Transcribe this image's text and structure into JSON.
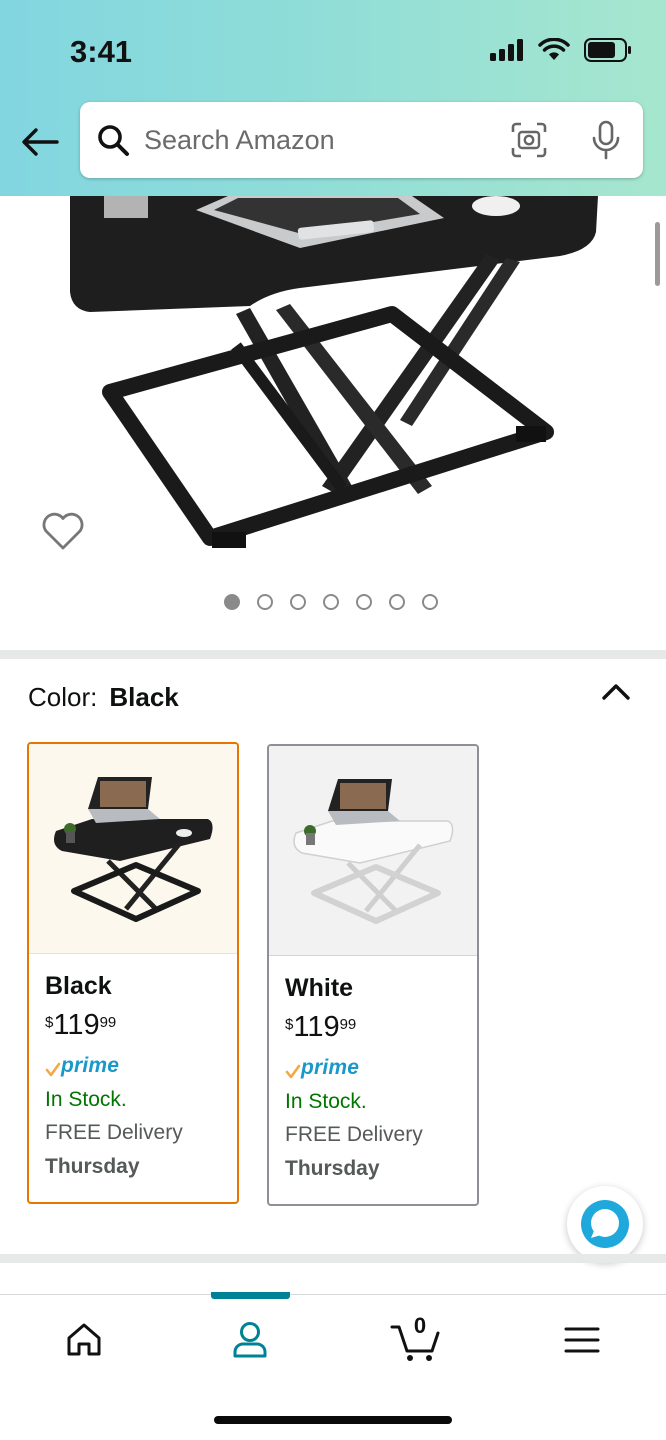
{
  "status_bar": {
    "time": "3:41"
  },
  "search": {
    "placeholder": "Search Amazon"
  },
  "image_gallery": {
    "total_images": 7,
    "active_index": 1
  },
  "color_selector": {
    "label": "Color:",
    "selected_value": "Black",
    "options": [
      {
        "name": "Black",
        "price_symbol": "$",
        "price_whole": "119",
        "price_fraction": "99",
        "prime_label": "prime",
        "stock": "In Stock.",
        "delivery": "FREE Delivery",
        "delivery_day": "Thursday",
        "selected": true
      },
      {
        "name": "White",
        "price_symbol": "$",
        "price_whole": "119",
        "price_fraction": "99",
        "prime_label": "prime",
        "stock": "In Stock.",
        "delivery": "FREE Delivery",
        "delivery_day": "Thursday",
        "selected": false
      }
    ]
  },
  "bottom_nav": {
    "items": [
      {
        "icon": "home-icon"
      },
      {
        "icon": "account-icon",
        "active": true
      },
      {
        "icon": "cart-icon",
        "count": "0"
      },
      {
        "icon": "menu-icon"
      }
    ]
  },
  "colors": {
    "header_gradient_start": "#82d6e0",
    "header_gradient_end": "#a6e6ce",
    "selected_border": "#e77600",
    "in_stock": "#007600",
    "prime_blue": "#1a98c9",
    "nav_active": "#008296"
  }
}
